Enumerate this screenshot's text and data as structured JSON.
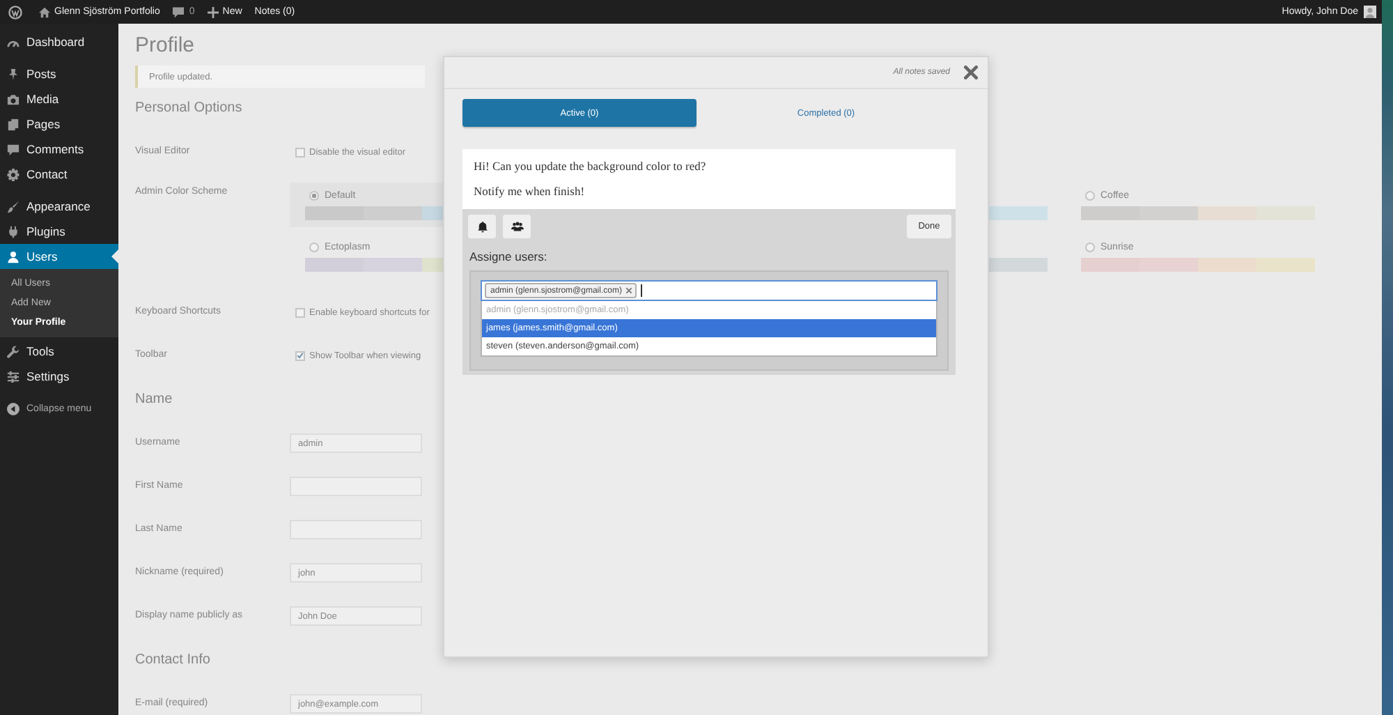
{
  "admin_bar": {
    "site_name": "Glenn Sjöström Portfolio",
    "comments_count": "0",
    "new_label": "New",
    "notes_label": "Notes (0)",
    "greeting": "Howdy, John Doe"
  },
  "sidebar": {
    "groups": [
      {
        "items": [
          {
            "label": "Dashboard",
            "selected": false
          }
        ]
      },
      {
        "items": [
          {
            "label": "Posts",
            "selected": false
          },
          {
            "label": "Media",
            "selected": false
          },
          {
            "label": "Pages",
            "selected": false
          },
          {
            "label": "Comments",
            "selected": false
          },
          {
            "label": "Contact",
            "selected": false
          }
        ]
      },
      {
        "items": [
          {
            "label": "Appearance",
            "selected": false
          },
          {
            "label": "Plugins",
            "selected": false
          },
          {
            "label": "Users",
            "selected": true,
            "children": [
              {
                "label": "All Users",
                "selected": false
              },
              {
                "label": "Add New",
                "selected": false
              },
              {
                "label": "Your Profile",
                "selected": true
              }
            ]
          },
          {
            "label": "Tools",
            "selected": false
          },
          {
            "label": "Settings",
            "selected": false
          }
        ]
      }
    ],
    "collapse_label": "Collapse menu"
  },
  "page": {
    "title": "Profile",
    "notice": "Profile updated.",
    "sections": [
      {
        "heading": "Personal Options",
        "rows": [
          {
            "kind": "checkbox",
            "label": "Visual Editor",
            "text": "Disable the visual editor",
            "checked": false
          },
          {
            "kind": "schemes",
            "label": "Admin Color Scheme",
            "schemes": [
              {
                "name": "Default",
                "selected": true,
                "swatches": [
                  {
                    "color": "#c9c9c9"
                  },
                  {
                    "color": "#cecece"
                  },
                  {
                    "color": "#c6d8e2"
                  }
                ]
              },
              {
                "swatches": [
                  {
                    "color": "#cfe1e8"
                  }
                ]
              },
              {
                "name": "Coffee",
                "selected": false,
                "swatches": [
                  {
                    "color": "#cfcdcc"
                  },
                  {
                    "color": "#d3d1cf"
                  },
                  {
                    "color": "#e7ddd3"
                  },
                  {
                    "color": "#e4e3d8"
                  }
                ]
              },
              {
                "name": "Ectoplasm",
                "selected": false,
                "swatches": [
                  {
                    "color": "#d2cfda"
                  },
                  {
                    "color": "#d6d2de"
                  },
                  {
                    "color": "#dfe2cd"
                  }
                ]
              },
              {
                "swatches": [
                  {
                    "color": "#d3d8da"
                  }
                ]
              },
              {
                "name": "Sunrise",
                "selected": false,
                "swatches": [
                  {
                    "color": "#e6cfcf"
                  },
                  {
                    "color": "#e8d3d2"
                  },
                  {
                    "color": "#ebdccd"
                  },
                  {
                    "color": "#e9e3c9"
                  }
                ]
              }
            ]
          },
          {
            "kind": "checkbox",
            "label": "Keyboard Shortcuts",
            "text": "Enable keyboard shortcuts for",
            "checked": false
          },
          {
            "kind": "checkbox",
            "label": "Toolbar",
            "text": "Show Toolbar when viewing",
            "checked": true
          }
        ]
      },
      {
        "heading": "Name",
        "rows": [
          {
            "kind": "field",
            "label": "Username",
            "value": "admin"
          },
          {
            "kind": "field",
            "label": "First Name"
          },
          {
            "kind": "field",
            "label": "Last Name"
          },
          {
            "kind": "field",
            "label": "Nickname (required)",
            "value": "john"
          },
          {
            "kind": "select",
            "label": "Display name publicly as",
            "value": "John Doe"
          }
        ]
      },
      {
        "heading": "Contact Info",
        "rows": [
          {
            "kind": "field",
            "label": "E-mail (required)",
            "value": "john@example.com"
          }
        ]
      }
    ]
  },
  "notes_modal": {
    "status": "All notes saved",
    "tabs": [
      {
        "label": "Active (0)",
        "selected": true
      },
      {
        "label": "Completed (0)",
        "selected": false
      }
    ],
    "note": {
      "lines": [
        "Hi! Can you update the background color to red?",
        "Notify me when finish!"
      ]
    },
    "done_label": "Done",
    "assign": {
      "heading": "Assigne users:",
      "chosen": [
        {
          "label": "admin (glenn.sjostrom@gmail.com)"
        }
      ],
      "options": [
        {
          "label": "admin (glenn.sjostrom@gmail.com)",
          "disabled": true,
          "selected": false
        },
        {
          "label": "james (james.smith@gmail.com)",
          "disabled": false,
          "selected": true
        },
        {
          "label": "steven (steven.anderson@gmail.com)",
          "disabled": false,
          "selected": false
        }
      ]
    }
  }
}
